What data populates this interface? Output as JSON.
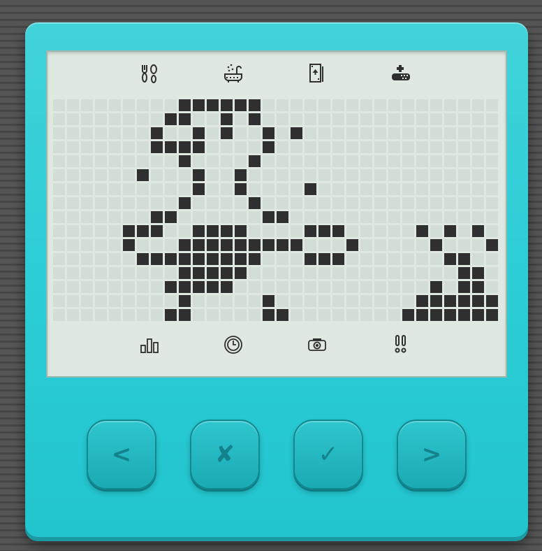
{
  "colors": {
    "background": "#4e4e4e",
    "device_body": "#2ccdd6",
    "lcd_background": "#dfe9e1",
    "pixel_on": "#2f2f2f",
    "pixel_off": "#d2ddd5",
    "button_glyph": "#13828a"
  },
  "top_menu": [
    {
      "icon": "food-icon"
    },
    {
      "icon": "bath-icon"
    },
    {
      "icon": "game-card-icon"
    },
    {
      "icon": "medicine-icon"
    }
  ],
  "bottom_menu": [
    {
      "icon": "stats-icon"
    },
    {
      "icon": "clock-icon"
    },
    {
      "icon": "camera-icon"
    },
    {
      "icon": "attention-icon"
    }
  ],
  "buttons": {
    "left": "<",
    "cancel": "✘",
    "confirm": "✓",
    "right": ">"
  },
  "lcd": {
    "columns": 32,
    "rows": 16,
    "pixels_on": [
      "000000000111111000000000000000000",
      "000000001100101000000000000000000",
      "000000010010100101000000000000000",
      "000000011110000100000000000000000",
      "000000000100001000000000000000000",
      "000000100010010000000000000000000",
      "000000000010010000100000000000000",
      "000000000100001000000000000000000",
      "000000011000000110000000000000000",
      "000001110011110000111000001010101",
      "000001000111111111000100000100010",
      "000000111111111000111000000011000",
      "000000000111110000000000000001100",
      "000000001111100000000000000101100",
      "000000000100000100000000001111110",
      "000000001100000110000000011111111"
    ]
  }
}
